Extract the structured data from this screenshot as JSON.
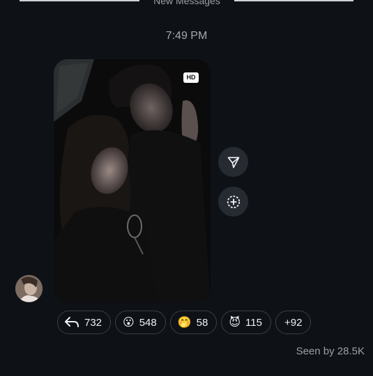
{
  "divider": {
    "label": "New Messages"
  },
  "timestamp": "7:49 PM",
  "photo": {
    "badge": "HD"
  },
  "actions": {
    "share_icon": "send-icon",
    "save_icon": "add-to-story-icon"
  },
  "reactions": [
    {
      "icon": "reply-arrow-icon",
      "emoji": "",
      "count": "732"
    },
    {
      "icon": "surprised-face-emoji",
      "emoji": "😮",
      "count": "548"
    },
    {
      "icon": "shushing-face-emoji",
      "emoji": "🤭",
      "count": "58"
    },
    {
      "icon": "devil-face-emoji",
      "emoji": "😈",
      "count": "115"
    },
    {
      "icon": "more-reactions",
      "emoji": "",
      "count": "+92"
    }
  ],
  "seen": "Seen by 28.5K",
  "colors": {
    "background": "#0e1217",
    "pill_border": "#3a3f47",
    "button_bg": "#262a31"
  }
}
